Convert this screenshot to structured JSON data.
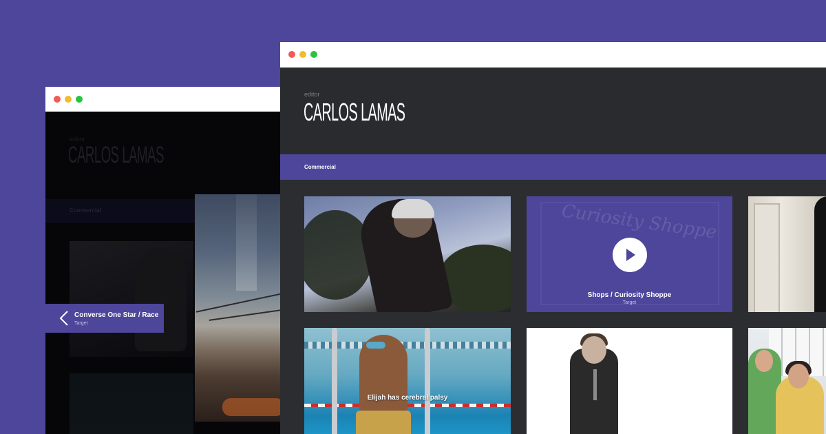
{
  "back_window": {
    "eyebrow": "editor",
    "title": "CARLOS LAMAS",
    "nav_item": "Commercial",
    "caption": {
      "title": "Converse One Star / Race",
      "subtitle": "Target"
    }
  },
  "front_window": {
    "eyebrow": "editor",
    "title": "CARLOS LAMAS",
    "nav_item": "Commercial",
    "thumbnails": [
      {
        "caption": ""
      },
      {
        "caption": "Shops / Curiosity Shoppe",
        "subtitle": "Target",
        "sign_text": "Curiosity Shoppe"
      },
      {
        "caption": ""
      },
      {
        "caption": "Elijah has cerebral palsy"
      },
      {
        "caption": ""
      },
      {
        "caption": ""
      }
    ]
  },
  "colors": {
    "background": "#4d469b",
    "accent": "#4d469b",
    "dark_bg": "#2c2d31",
    "window_chrome": "#ffffff",
    "traffic_red": "#f25a55",
    "traffic_yellow": "#f3bc2e",
    "traffic_green": "#27c53f"
  },
  "icons": {
    "traffic_lights": [
      "close-dot",
      "minimize-dot",
      "zoom-dot"
    ],
    "play": "play-icon",
    "chevron": "chevron-left-icon"
  }
}
